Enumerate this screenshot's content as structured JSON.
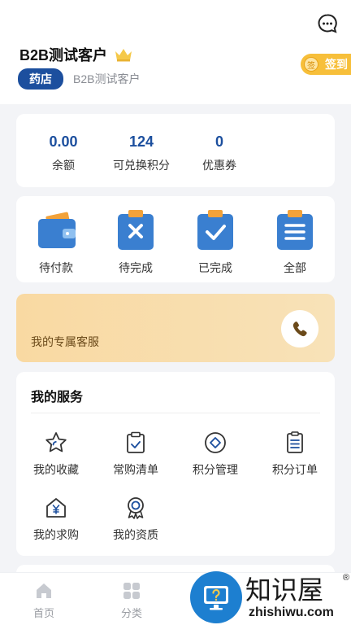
{
  "header": {
    "user_name": "B2B测试客户",
    "store_tag": "药店",
    "store_subtitle": "B2B测试客户",
    "signin_label": "签到",
    "signin_icon_text": "签"
  },
  "stats": [
    {
      "value": "0.00",
      "label": "余额"
    },
    {
      "value": "124",
      "label": "可兑换积分"
    },
    {
      "value": "0",
      "label": "优惠券"
    }
  ],
  "orders": [
    {
      "label": "待付款",
      "icon": "wallet-icon"
    },
    {
      "label": "待完成",
      "icon": "clipboard-x-icon"
    },
    {
      "label": "已完成",
      "icon": "clipboard-check-icon"
    },
    {
      "label": "全部",
      "icon": "clipboard-list-icon"
    }
  ],
  "banner": {
    "label": "我的专属客服",
    "icon": "phone-icon"
  },
  "services": {
    "title": "我的服务",
    "items": [
      {
        "label": "我的收藏",
        "icon": "star-icon"
      },
      {
        "label": "常购清单",
        "icon": "clipboard-check-icon"
      },
      {
        "label": "积分管理",
        "icon": "diamond-circle-icon"
      },
      {
        "label": "积分订单",
        "icon": "document-icon"
      },
      {
        "label": "我的求购",
        "icon": "yen-house-icon"
      },
      {
        "label": "我的资质",
        "icon": "badge-icon"
      }
    ]
  },
  "tabbar": [
    {
      "label": "首页",
      "icon": "home-icon"
    },
    {
      "label": "分类",
      "icon": "grid-icon"
    }
  ],
  "watermark": {
    "title": "知识屋",
    "url": "zhishiwu.com",
    "reg": "®"
  },
  "colors": {
    "primary": "#1c4f9e",
    "accent": "#3a7fd0",
    "gold": "#f7bf3a"
  }
}
